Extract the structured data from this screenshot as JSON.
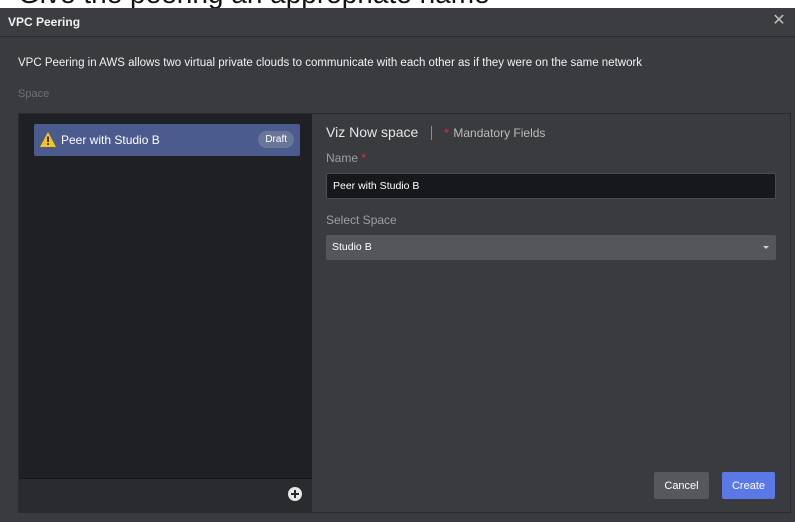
{
  "dialog": {
    "title": "VPC Peering",
    "description": "VPC Peering in AWS allows two virtual private clouds to communicate with each other as if they were on the same network",
    "section_label": "Space"
  },
  "space_list": {
    "items": [
      {
        "label": "Peer with Studio B",
        "badge": "Draft",
        "icon": "warning-icon"
      }
    ]
  },
  "form": {
    "title": "Viz Now space",
    "required_marker": "*",
    "mandatory_text": "Mandatory Fields",
    "name_label": "Name",
    "name_value": "Peer with Studio B",
    "select_label": "Select Space",
    "select_value": "Studio B"
  },
  "buttons": {
    "cancel": "Cancel",
    "create": "Create"
  },
  "colors": {
    "accent": "#5b79e6",
    "selected_item": "#4c5b8e",
    "required": "#e0303d",
    "warning": "#f5c518"
  }
}
